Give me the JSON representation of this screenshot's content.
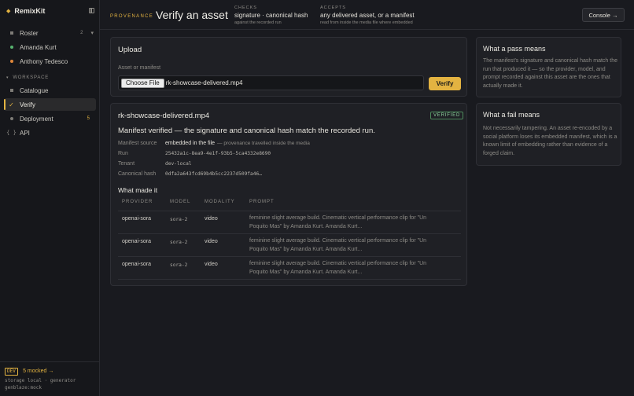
{
  "app": {
    "name": "RemixKit"
  },
  "sidebar": {
    "items": [
      {
        "label": "Roster",
        "badge": "2"
      },
      {
        "label": "Amanda Kurt"
      },
      {
        "label": "Anthony Tedesco"
      }
    ],
    "section": "WORKSPACE",
    "workspace_items": [
      {
        "label": "Catalogue"
      },
      {
        "label": "Verify"
      },
      {
        "label": "Deployment",
        "badge": "5"
      },
      {
        "label": "API"
      }
    ],
    "footer": {
      "env": "DEV",
      "mocked": "5 mocked →",
      "storage": "storage local · generator",
      "genblaze": "genblaze:mock"
    }
  },
  "header": {
    "eyebrow": "PROVENANCE",
    "title": "Verify an asset",
    "checks": {
      "key": "CHECKS",
      "value": "signature · canonical hash",
      "sub": "against the recorded run"
    },
    "accepts": {
      "key": "ACCEPTS",
      "value": "any delivered asset, or a manifest",
      "sub": "read from inside the media file where embedded"
    },
    "console": "Console →"
  },
  "upload": {
    "title": "Upload",
    "field_label": "Asset or manifest",
    "choose": "Choose File",
    "file_name": "rk-showcase-delivered.mp4",
    "verify": "Verify"
  },
  "result": {
    "file_name": "rk-showcase-delivered.mp4",
    "status": "VERIFIED",
    "headline": "Manifest verified — the signature and canonical hash match the recorded run.",
    "rows": [
      {
        "key": "Manifest source",
        "value": "embedded in the file",
        "note": "— provenance travelled inside the media"
      },
      {
        "key": "Run",
        "value": "25432a1c-8ea9-4e1f-93b5-5ca4332e8690"
      },
      {
        "key": "Tenant",
        "value": "dev-local"
      },
      {
        "key": "Canonical hash",
        "value": "0dfa2a643fcd69b4b5cc2237d509fa46…"
      }
    ],
    "made_title": "What made it",
    "table": {
      "headers": [
        "PROVIDER",
        "MODEL",
        "MODALITY",
        "PROMPT"
      ],
      "rows": [
        {
          "provider": "openai-sora",
          "model": "sora-2",
          "modality": "video",
          "prompt": "feminine slight average build. Cinematic vertical performance clip for \"Un Poquito Mas\" by Amanda Kurt. Amanda Kurt..."
        },
        {
          "provider": "openai-sora",
          "model": "sora-2",
          "modality": "video",
          "prompt": "feminine slight average build. Cinematic vertical performance clip for \"Un Poquito Mas\" by Amanda Kurt. Amanda Kurt..."
        },
        {
          "provider": "openai-sora",
          "model": "sora-2",
          "modality": "video",
          "prompt": "feminine slight average build. Cinematic vertical performance clip for \"Un Poquito Mas\" by Amanda Kurt. Amanda Kurt..."
        }
      ]
    }
  },
  "info": {
    "pass_title": "What a pass means",
    "pass_text": "The manifest's signature and canonical hash match the run that produced it — so the provider, model, and prompt recorded against this asset are the ones that actually made it.",
    "fail_title": "What a fail means",
    "fail_text": "Not necessarily tampering. An asset re-encoded by a social platform loses its embedded manifest, which is a known limit of embedding rather than evidence of a forged claim."
  },
  "colors": {
    "accent": "#e3b341",
    "success": "#8fd3a0",
    "dot_green": "#57b36f",
    "dot_orange": "#e0873a"
  }
}
